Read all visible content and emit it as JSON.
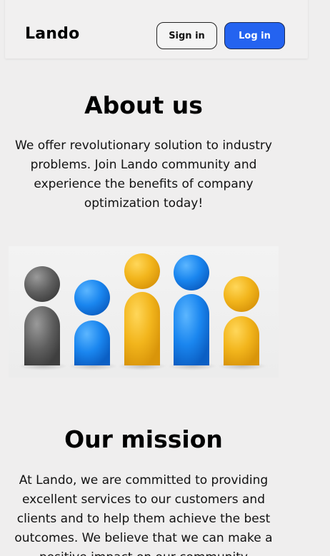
{
  "header": {
    "brand": "Lando",
    "signin_label": "Sign in",
    "login_label": "Log in"
  },
  "about": {
    "title": "About us",
    "text": "We offer revolutionary solution to industry problems. Join Lando community and experience the benefits of company optimization today!"
  },
  "illustration": {
    "figures": [
      "gray",
      "blue",
      "yellow",
      "blue",
      "yellow"
    ]
  },
  "mission": {
    "title": "Our mission",
    "text": "At Lando, we are committed to providing excellent services to our customers and clients and to help them achieve the best outcomes. We believe that we can make a positive impact on our community"
  },
  "colors": {
    "accent_blue": "#2463f0",
    "figure_gray": "#6b6b6b",
    "figure_blue": "#1f8af0",
    "figure_yellow": "#f2b824",
    "background": "#efeeee"
  }
}
